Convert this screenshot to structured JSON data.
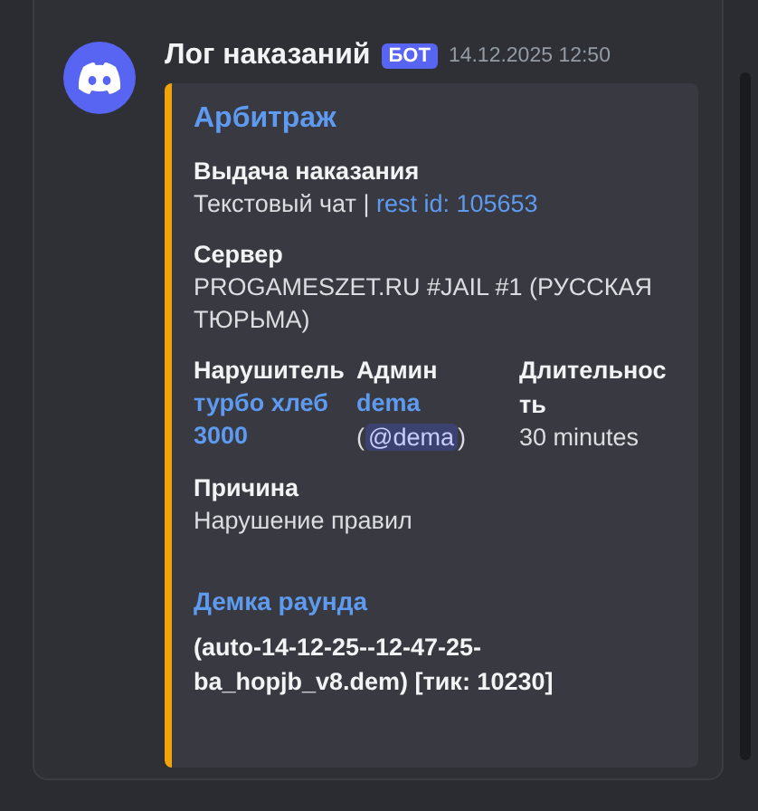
{
  "message": {
    "author": "Лог наказаний",
    "badge": "БОТ",
    "timestamp": "14.12.2025 12:50",
    "embed": {
      "title": "Арбитраж",
      "field_rows": [
        [
          {
            "kind": "text_link",
            "name": "Выдача наказания",
            "text": "Текстовый чат",
            "separator": "|",
            "link": "rest id: 105653"
          }
        ],
        [
          {
            "kind": "text",
            "name": "Сервер",
            "value": "PROGAMESZET.RU #JAIL #1 (РУССКАЯ ТЮРЬМА)"
          }
        ],
        [
          {
            "kind": "link",
            "name": "Нарушитель",
            "link": "турбо хлеб 3000"
          },
          {
            "kind": "user",
            "name": "Админ",
            "link": "dema",
            "open": "(",
            "mention": "@dema",
            "close": ")"
          },
          {
            "kind": "text",
            "name": "Длительность",
            "value": "30 minutes"
          }
        ],
        [
          {
            "kind": "text",
            "name": "Причина",
            "value": "Нарушение правил"
          }
        ]
      ],
      "demo": {
        "title": "Демка раунда",
        "value": "(auto-14-12-25--12-47-25-ba_hopjb_v8.dem) [тик: 10230]"
      }
    }
  }
}
